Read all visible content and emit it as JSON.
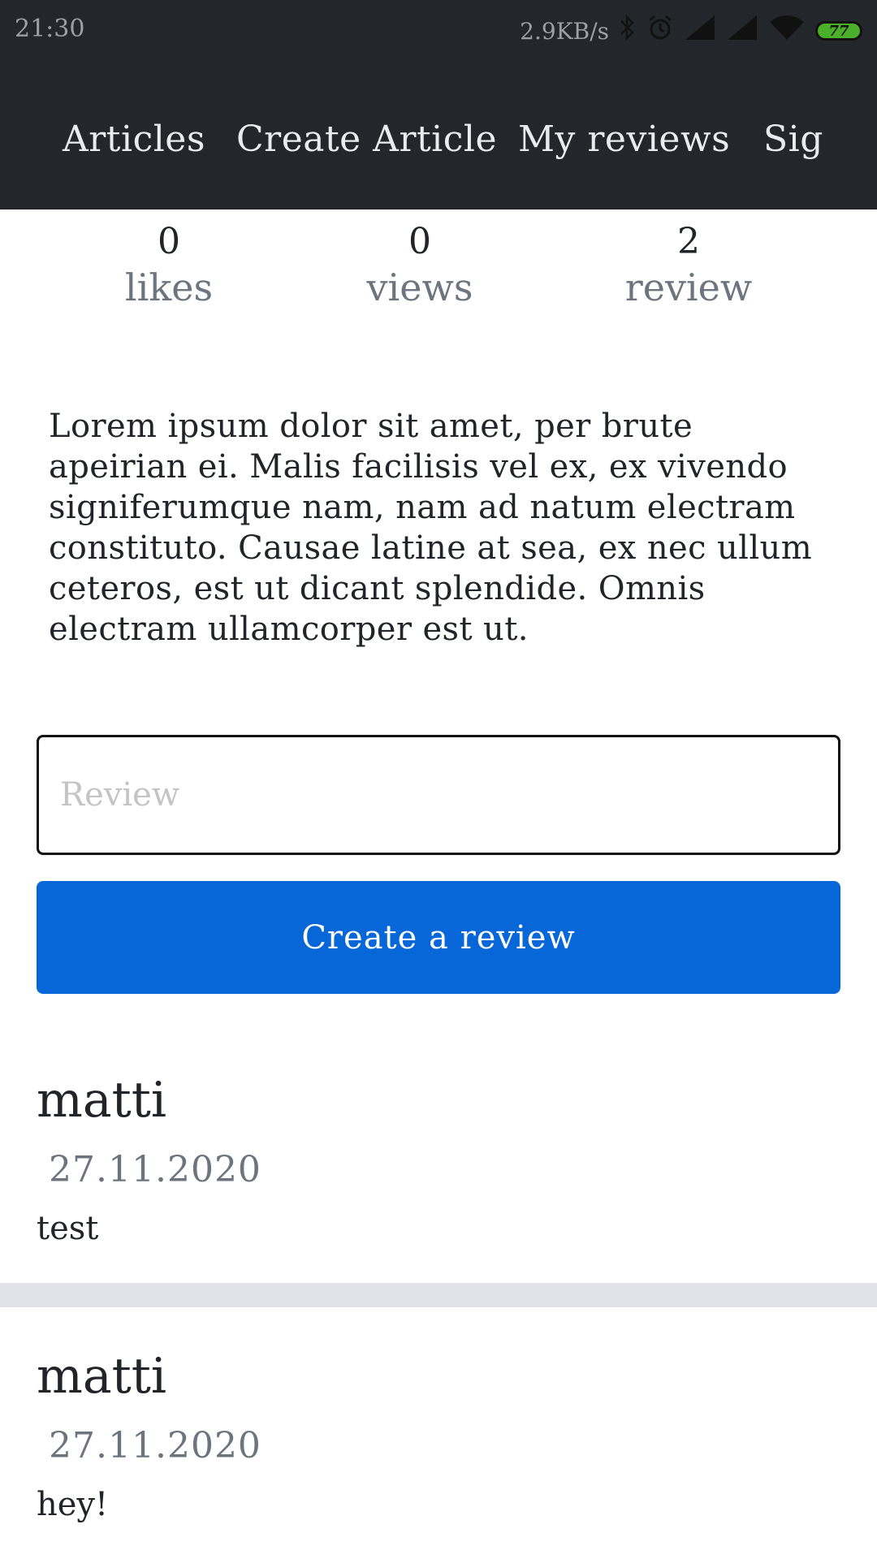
{
  "status_bar": {
    "time": "21:30",
    "network_speed": "2.9KB/s",
    "battery": "77",
    "icons": [
      "bluetooth-icon",
      "alarm-icon",
      "signal-icon",
      "signal-icon",
      "wifi-icon",
      "battery-icon"
    ]
  },
  "nav": {
    "items": [
      {
        "label": "Articles"
      },
      {
        "label": "Create Article"
      },
      {
        "label": "My reviews"
      },
      {
        "label": "Sig"
      }
    ]
  },
  "stats": {
    "likes": {
      "value": "0",
      "label": "likes"
    },
    "views": {
      "value": "0",
      "label": "views"
    },
    "reviews": {
      "value": "2",
      "label": "review"
    }
  },
  "article": {
    "body": "Lorem ipsum dolor sit amet, per brute apeirian ei. Malis facilisis vel ex, ex vivendo signiferumque nam, nam ad natum electram constituto. Causae latine at sea, ex nec ullum ceteros, est ut dicant splendide. Omnis electram ullamcorper est ut."
  },
  "review_form": {
    "placeholder": "Review",
    "value": "",
    "submit_label": "Create a review"
  },
  "reviews": [
    {
      "author": "matti",
      "date": "27.11.2020",
      "text": "test"
    },
    {
      "author": "matti",
      "date": "27.11.2020",
      "text": "hey!"
    }
  ],
  "colors": {
    "navbar": "#23272b",
    "primary_button": "#0767d8",
    "muted_text": "#6c757d",
    "divider": "#e0e3e7"
  }
}
